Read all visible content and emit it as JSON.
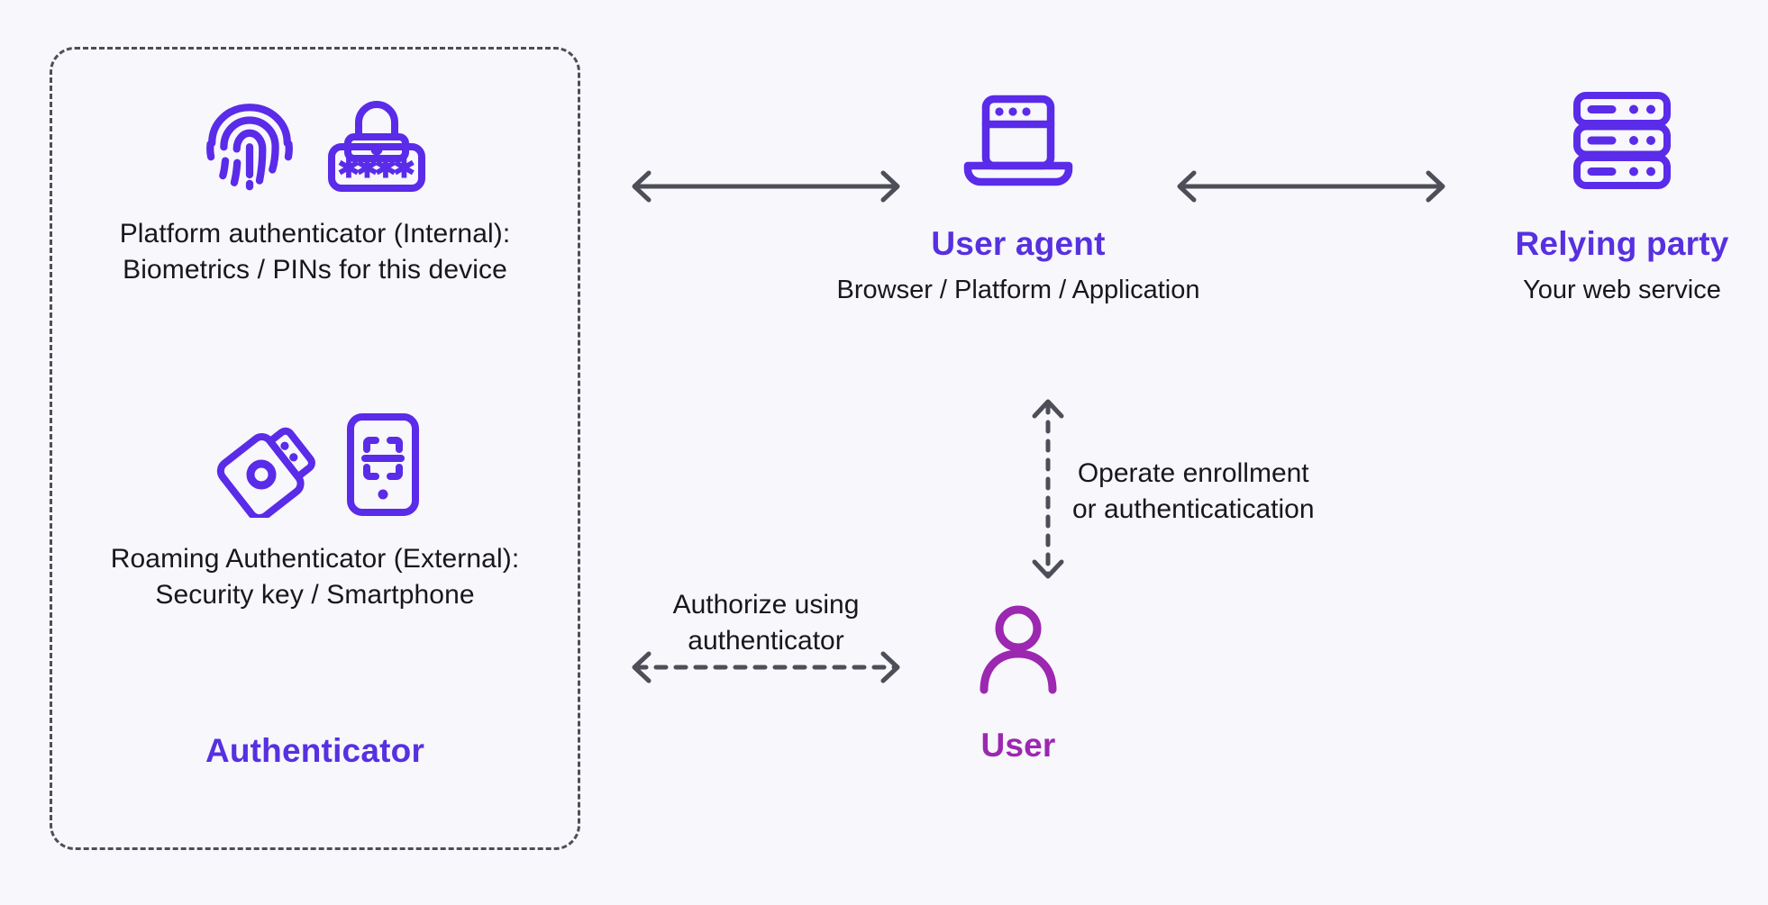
{
  "theme": {
    "background": "#f7f7fc",
    "purple": "#5730e0",
    "icon_purple": "#5a2be8",
    "magenta": "#9c27b0",
    "text": "#17171c",
    "arrow_gray": "#4e4e58"
  },
  "authenticator_box": {
    "title": "Authenticator",
    "platform": {
      "icons": [
        "fingerprint-icon",
        "pin-lock-icon"
      ],
      "caption_line1": "Platform authenticator (Internal):",
      "caption_line2": "Biometrics / PINs for this device"
    },
    "roaming": {
      "icons": [
        "usb-security-key-icon",
        "smartphone-faceid-icon"
      ],
      "caption_line1": "Roaming Authenticator (External):",
      "caption_line2": "Security key / Smartphone"
    }
  },
  "user_agent": {
    "icon": "laptop-icon",
    "title": "User agent",
    "subtitle": "Browser / Platform / Application"
  },
  "relying_party": {
    "icon": "server-stack-icon",
    "title": "Relying party",
    "subtitle": "Your web service"
  },
  "user": {
    "icon": "person-icon",
    "title": "User"
  },
  "connections": {
    "authenticator_to_user_agent": {
      "style": "solid",
      "direction": "bidirectional",
      "label": ""
    },
    "user_agent_to_relying_party": {
      "style": "solid",
      "direction": "bidirectional",
      "label": ""
    },
    "user_agent_to_user": {
      "style": "dashed",
      "direction": "bidirectional",
      "label_line1": "Operate enrollment",
      "label_line2": "or authenticatication"
    },
    "authenticator_to_user": {
      "style": "dashed",
      "direction": "bidirectional",
      "label_line1": "Authorize using",
      "label_line2": "authenticator"
    }
  }
}
